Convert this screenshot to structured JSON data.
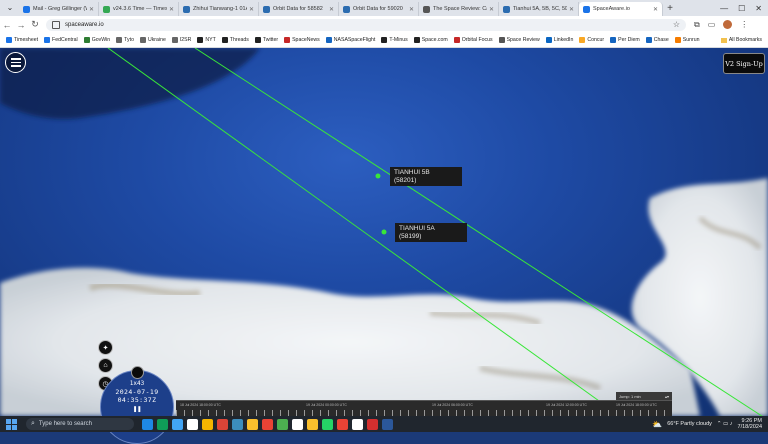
{
  "browser": {
    "tabs": [
      {
        "title": "Mail - Greg Gillinger (Wri",
        "color": "#1a73e8",
        "active": false
      },
      {
        "title": "v24.3.6 Time — Timeshe",
        "color": "#34a853",
        "active": false
      },
      {
        "title": "Zhihui Tianwang-1 01A/",
        "color": "#2b6cb0",
        "active": false
      },
      {
        "title": "Orbit Data for 58582",
        "color": "#2b6cb0",
        "active": false
      },
      {
        "title": "Orbit Data for 59020",
        "color": "#2b6cb0",
        "active": false
      },
      {
        "title": "The Space Review: Canvi",
        "color": "#555555",
        "active": false
      },
      {
        "title": "Tianhui 5A, 5B, 5C, 5D (T",
        "color": "#2b6cb0",
        "active": false
      },
      {
        "title": "SpaceAware.io",
        "color": "#1a73e8",
        "active": true
      }
    ],
    "new_tab": "+",
    "url": "spaceaware.io",
    "bookmarks": [
      {
        "label": "Timesheet",
        "color": "#1a73e8"
      },
      {
        "label": "FedCentral",
        "color": "#1a73e8"
      },
      {
        "label": "GovWin",
        "color": "#2e7d32"
      },
      {
        "label": "Tyto",
        "color": "#666666"
      },
      {
        "label": "Ukraine",
        "color": "#666666"
      },
      {
        "label": "I2SR",
        "color": "#666666"
      },
      {
        "label": "NYT",
        "color": "#222222"
      },
      {
        "label": "Threads",
        "color": "#222222"
      },
      {
        "label": "Twitter",
        "color": "#222222"
      },
      {
        "label": "SpaceNews",
        "color": "#c62828"
      },
      {
        "label": "NASASpaceFlight",
        "color": "#1565c0"
      },
      {
        "label": "T-Minus",
        "color": "#222222"
      },
      {
        "label": "Space.com",
        "color": "#222222"
      },
      {
        "label": "Orbital Focus",
        "color": "#c62828"
      },
      {
        "label": "Space Review",
        "color": "#555555"
      },
      {
        "label": "LinkedIn",
        "color": "#0a66c2"
      },
      {
        "label": "Concur",
        "color": "#f9a825"
      },
      {
        "label": "Per Diem",
        "color": "#1565c0"
      },
      {
        "label": "Chase",
        "color": "#1565c0"
      },
      {
        "label": "Sunrun",
        "color": "#f57c00"
      }
    ],
    "all_bookmarks": "All Bookmarks"
  },
  "app": {
    "signup_label": "V2 Sign-Up",
    "satellites": [
      {
        "name": "TIANHUI 5B",
        "id": "(58201)"
      },
      {
        "name": "TIANHUI 5A",
        "id": "(58199)"
      }
    ],
    "clock": {
      "speed": "1x43",
      "date": "2024-07-19",
      "time": "04:35:37Z",
      "pause": "❚❚"
    },
    "timeline": {
      "labels": [
        "18 Jul 2024 18:00:00 UTC",
        "19 Jul 2024 00:00:00 UTC",
        "19 Jul 2024 06:00:00 UTC",
        "19 Jul 2024 12:00:00 UTC",
        "19 Jul 2024 18:00:00 UTC"
      ],
      "zoom_label": "Jump: 1 min"
    }
  },
  "taskbar": {
    "search_placeholder": "Type here to search",
    "weather": "66°F  Partly cloudy",
    "time": "9:26 PM",
    "date": "7/18/2024",
    "app_colors": [
      "#1e88e5",
      "#0f9d58",
      "#42a5f5",
      "#ffffff",
      "#f4b400",
      "#db4437",
      "#3c8dbc",
      "#fbc02d",
      "#ea4335",
      "#4caf50",
      "#ffffff",
      "#fbc02d",
      "#25d366",
      "#ea4335",
      "#ffffff",
      "#d32f2f",
      "#2b579a"
    ]
  }
}
